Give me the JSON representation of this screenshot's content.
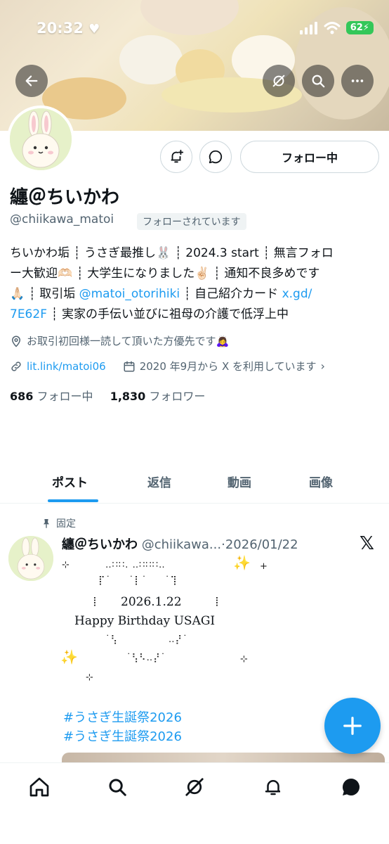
{
  "status_bar": {
    "time": "20:32",
    "battery": "62"
  },
  "profile": {
    "name": "纏＠ちいかわ",
    "handle": "@chiikawa_matoi",
    "follows_you": "フォローされています",
    "follow_button": "フォロー中",
    "bio_lines": [
      "ちいかわ垢 ┊ うさぎ最推し🐰 ┊ 2024.3 start ┊ 無言フォロ",
      "ー大歓迎🫶🏻 ┊ 大学生になりました✌🏻 ┊ 通知不良多めです",
      "🙏🏻 ┊ 取引垢 ",
      "@matoi_otorihiki",
      " ┊ 自己紹介カード ",
      "x.gd/",
      "7E62F",
      " ┊ 実家の手伝い並びに祖母の介護で低浮上中"
    ],
    "location": "お取引初回様一読して頂いた方優先です🙇‍♀️",
    "website": "lit.link/matoi06",
    "joined": "2020 年9月から X を利用しています",
    "following_count": "686",
    "following_label": "フォロー中",
    "followers_count": "1,830",
    "followers_label": "フォロワー"
  },
  "tabs": [
    {
      "label": "ポスト"
    },
    {
      "label": "返信"
    },
    {
      "label": "動画"
    },
    {
      "label": "画像"
    }
  ],
  "post": {
    "pinned_label": "固定",
    "author_name": "纏＠ちいかわ",
    "author_handle": "@chiikawa...",
    "date": "2026/01/22",
    "bday_date": "2026.1.22",
    "bday_message": "Happy Birthday USAGI",
    "hashtag_1": "#うさぎ生誕祭2026",
    "hashtag_2": "#うさぎ生誕祭2026"
  },
  "icons": {
    "back": "arrow-left-icon",
    "grok": "grok-icon",
    "search": "search-icon",
    "more": "more-icon",
    "notify": "bell-plus-icon",
    "message": "chat-bubble-icon",
    "fab": "plus-icon"
  },
  "colors": {
    "accent": "#1d9bf0",
    "text": "#0f1419",
    "muted": "#536471"
  }
}
